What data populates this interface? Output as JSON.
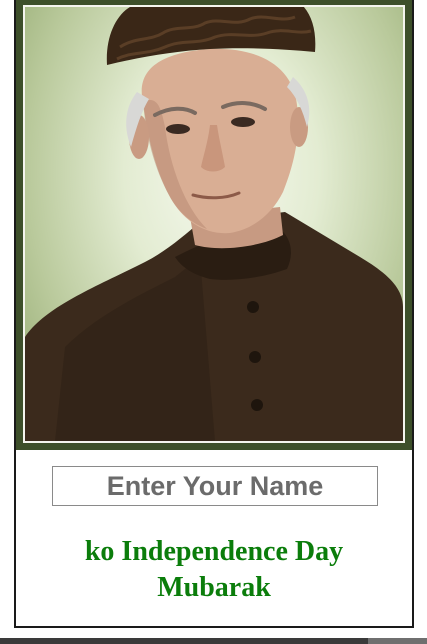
{
  "portrait": {
    "alt": "Portrait of a man wearing a karakul cap and dark sherwani"
  },
  "name_input": {
    "placeholder": "Enter Your Name",
    "value": ""
  },
  "greeting": {
    "line1": "ko Independence Day",
    "line2": "Mubarak"
  },
  "colors": {
    "frame": "#3d4f2a",
    "greeting_text": "#0b7d0b",
    "placeholder_text": "#6b6b6b"
  }
}
